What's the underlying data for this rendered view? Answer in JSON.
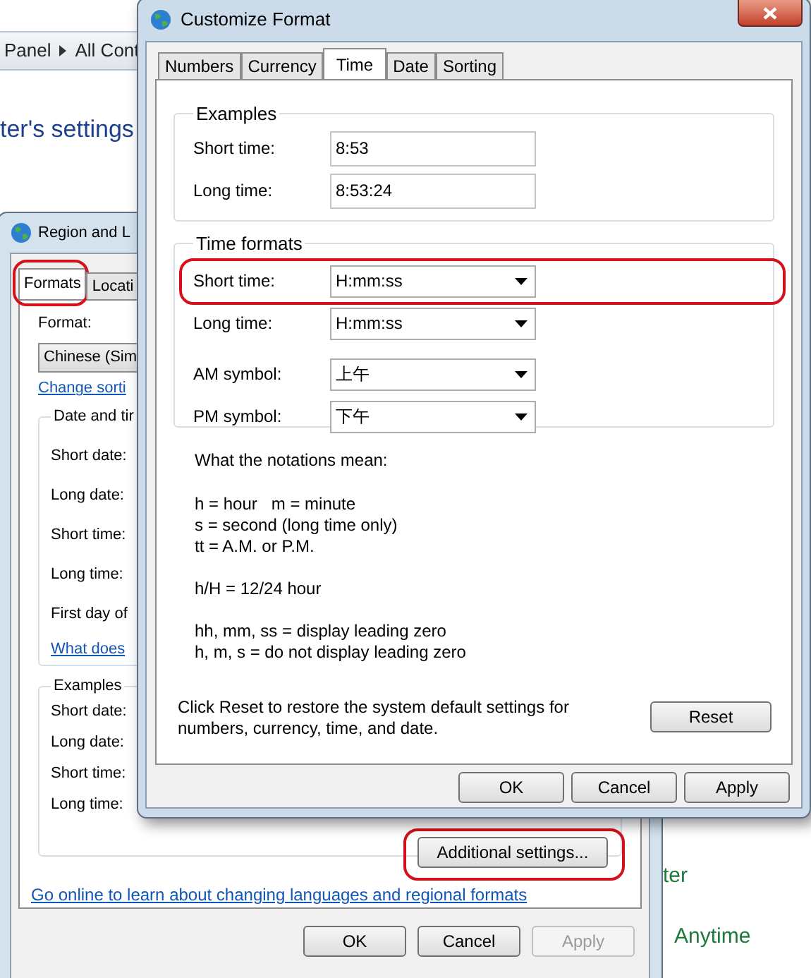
{
  "background": {
    "breadcrumb": [
      "Panel",
      "All Cont"
    ],
    "heading": "ter's settings",
    "side_texts": [
      "ter",
      "Anytime"
    ]
  },
  "region_dialog": {
    "title": "Region and L",
    "tabs": [
      {
        "label": "Formats",
        "selected": true,
        "highlighted": true
      },
      {
        "label": "Locati",
        "selected": false,
        "highlighted": false
      }
    ],
    "format_label": "Format:",
    "format_value": "Chinese (Sim",
    "sort_link": "Change sorti",
    "date_time_group": {
      "title": "Date and tir",
      "rows": [
        "Short date:",
        "Long date:",
        "Short time:",
        "Long time:",
        "First day of"
      ],
      "link": "What does"
    },
    "examples_group": {
      "title": "Examples",
      "rows": [
        "Short date:",
        "Long date:",
        "Short time:",
        "Long time:"
      ]
    },
    "additional_button": {
      "label": "Additional settings...",
      "highlighted": true
    },
    "online_link": "Go online to learn about changing languages and regional formats",
    "buttons": [
      {
        "label": "OK",
        "disabled": false
      },
      {
        "label": "Cancel",
        "disabled": false
      },
      {
        "label": "Apply",
        "disabled": true
      }
    ]
  },
  "customize_dialog": {
    "title": "Customize Format",
    "tabs": [
      {
        "label": "Numbers",
        "selected": false
      },
      {
        "label": "Currency",
        "selected": false
      },
      {
        "label": "Time",
        "selected": true
      },
      {
        "label": "Date",
        "selected": false
      },
      {
        "label": "Sorting",
        "selected": false
      }
    ],
    "examples": {
      "title": "Examples",
      "rows": [
        {
          "label": "Short time:",
          "value": "8:53"
        },
        {
          "label": "Long time:",
          "value": "8:53:24"
        }
      ]
    },
    "time_formats": {
      "title": "Time formats",
      "rows": [
        {
          "label": "Short time:",
          "value": "H:mm:ss",
          "highlighted": true
        },
        {
          "label": "Long time:",
          "value": "H:mm:ss",
          "highlighted": false
        },
        {
          "label": "AM symbol:",
          "value": "上午",
          "highlighted": false
        },
        {
          "label": "PM symbol:",
          "value": "下午",
          "highlighted": false
        }
      ]
    },
    "notations_title": "What the notations mean:",
    "notation_groups": [
      [
        "h = hour   m = minute",
        "s = second (long time only)",
        "tt = A.M. or P.M."
      ],
      [
        "h/H = 12/24 hour"
      ],
      [
        "hh, mm, ss = display leading zero",
        "h, m, s = do not display leading zero"
      ]
    ],
    "reset_note": "Click Reset to restore the system default settings for numbers, currency, time, and date.",
    "reset_button": "Reset",
    "buttons": [
      {
        "label": "OK",
        "disabled": false
      },
      {
        "label": "Cancel",
        "disabled": false
      },
      {
        "label": "Apply",
        "disabled": false
      }
    ]
  }
}
